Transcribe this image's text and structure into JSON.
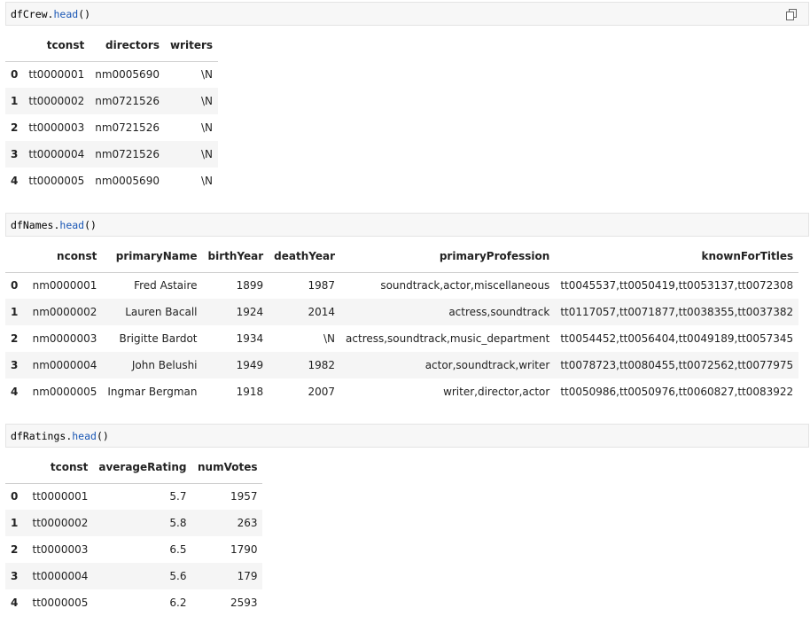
{
  "cells": [
    {
      "code_object": "dfCrew",
      "code_method": "head",
      "code_suffix": "()",
      "columns": [
        "tconst",
        "directors",
        "writers"
      ],
      "rows": [
        {
          "index": "0",
          "values": [
            "tt0000001",
            "nm0005690",
            "\\N"
          ]
        },
        {
          "index": "1",
          "values": [
            "tt0000002",
            "nm0721526",
            "\\N"
          ]
        },
        {
          "index": "2",
          "values": [
            "tt0000003",
            "nm0721526",
            "\\N"
          ]
        },
        {
          "index": "3",
          "values": [
            "tt0000004",
            "nm0721526",
            "\\N"
          ]
        },
        {
          "index": "4",
          "values": [
            "tt0000005",
            "nm0005690",
            "\\N"
          ]
        }
      ]
    },
    {
      "code_object": "dfNames",
      "code_method": "head",
      "code_suffix": "()",
      "columns": [
        "nconst",
        "primaryName",
        "birthYear",
        "deathYear",
        "primaryProfession",
        "knownForTitles"
      ],
      "rows": [
        {
          "index": "0",
          "values": [
            "nm0000001",
            "Fred Astaire",
            "1899",
            "1987",
            "soundtrack,actor,miscellaneous",
            "tt0045537,tt0050419,tt0053137,tt0072308"
          ]
        },
        {
          "index": "1",
          "values": [
            "nm0000002",
            "Lauren Bacall",
            "1924",
            "2014",
            "actress,soundtrack",
            "tt0117057,tt0071877,tt0038355,tt0037382"
          ]
        },
        {
          "index": "2",
          "values": [
            "nm0000003",
            "Brigitte Bardot",
            "1934",
            "\\N",
            "actress,soundtrack,music_department",
            "tt0054452,tt0056404,tt0049189,tt0057345"
          ]
        },
        {
          "index": "3",
          "values": [
            "nm0000004",
            "John Belushi",
            "1949",
            "1982",
            "actor,soundtrack,writer",
            "tt0078723,tt0080455,tt0072562,tt0077975"
          ]
        },
        {
          "index": "4",
          "values": [
            "nm0000005",
            "Ingmar Bergman",
            "1918",
            "2007",
            "writer,director,actor",
            "tt0050986,tt0050976,tt0060827,tt0083922"
          ]
        }
      ]
    },
    {
      "code_object": "dfRatings",
      "code_method": "head",
      "code_suffix": "()",
      "columns": [
        "tconst",
        "averageRating",
        "numVotes"
      ],
      "rows": [
        {
          "index": "0",
          "values": [
            "tt0000001",
            "5.7",
            "1957"
          ]
        },
        {
          "index": "1",
          "values": [
            "tt0000002",
            "5.8",
            "263"
          ]
        },
        {
          "index": "2",
          "values": [
            "tt0000003",
            "6.5",
            "1790"
          ]
        },
        {
          "index": "3",
          "values": [
            "tt0000004",
            "5.6",
            "179"
          ]
        },
        {
          "index": "4",
          "values": [
            "tt0000005",
            "6.2",
            "2593"
          ]
        }
      ]
    }
  ],
  "icons": {
    "copy": "copy-icon"
  },
  "colors": {
    "method": "#1a57b5",
    "code_bg": "#f7f7f7",
    "stripe": "#f5f5f5"
  }
}
